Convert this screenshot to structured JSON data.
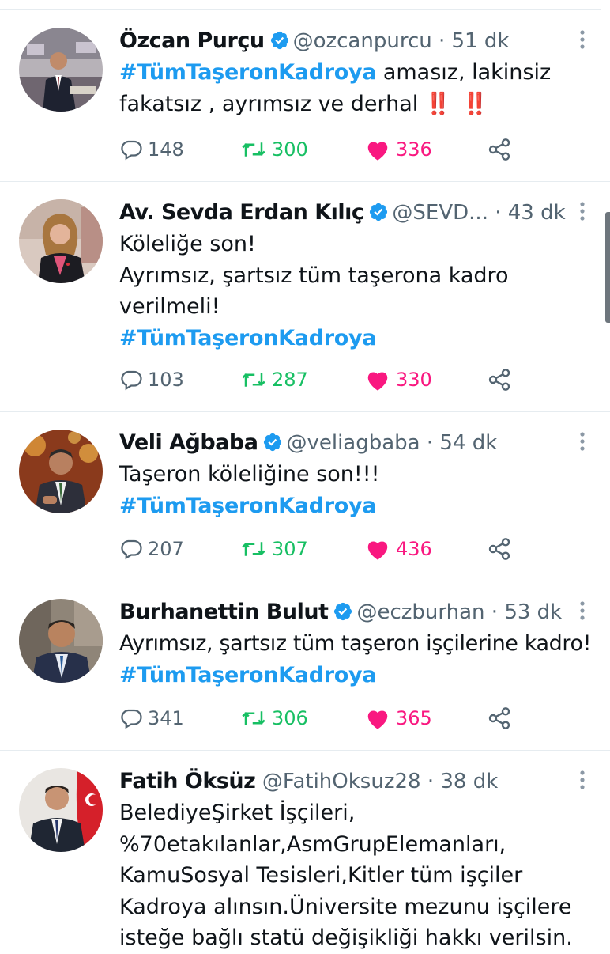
{
  "colors": {
    "hashtag": "#1d9bf0",
    "verified": "#1d9bf0",
    "retweet": "#17bf63",
    "like": "#f91880",
    "muted": "#536471"
  },
  "tweets": [
    {
      "name": "Özcan Purçu",
      "verified": true,
      "handle": "@ozcanpurcu",
      "time": "51 dk",
      "text": "amasız, lakinsiz fakatsız , ayrımsız ve derhal",
      "hashtag": "#TümTaşeronKadroya",
      "emoji": "‼️ ‼️",
      "replies": "148",
      "retweets": "300",
      "likes": "336"
    },
    {
      "name": "Av. Sevda Erdan Kılıç",
      "verified": true,
      "handle": "@SEVD...",
      "time": "43 dk",
      "line1": "Köleliğe son!",
      "line2": "Ayrımsız, şartsız tüm taşerona kadro verilmeli!",
      "hashtag": "#TümTaşeronKadroya",
      "replies": "103",
      "retweets": "287",
      "likes": "330"
    },
    {
      "name": "Veli Ağbaba",
      "verified": true,
      "handle": "@veliagbaba",
      "time": "54 dk",
      "line1": "Taşeron köleliğine son!!!",
      "hashtag": "#TümTaşeronKadroya",
      "replies": "207",
      "retweets": "307",
      "likes": "436"
    },
    {
      "name": "Burhanettin Bulut",
      "verified": true,
      "handle": "@eczburhan",
      "time": "53 dk",
      "line1": "Ayrımsız, şartsız tüm taşeron işçilerine kadro!",
      "hashtag": "#TümTaşeronKadroya",
      "replies": "341",
      "retweets": "306",
      "likes": "365"
    },
    {
      "name": "Fatih Öksüz",
      "verified": false,
      "handle": "@FatihOksuz28",
      "time": "38 dk",
      "lines": [
        "BelediyeŞirket İşçileri,",
        "%70etakılanlar,AsmGrupElemanları,",
        "KamuSosyal Tesisleri,Kitler tüm işçiler",
        "Kadroya alınsın.Üniversite mezunu işçilere",
        "isteğe bağlı statü değişikliği hakkı verilsin."
      ]
    }
  ]
}
